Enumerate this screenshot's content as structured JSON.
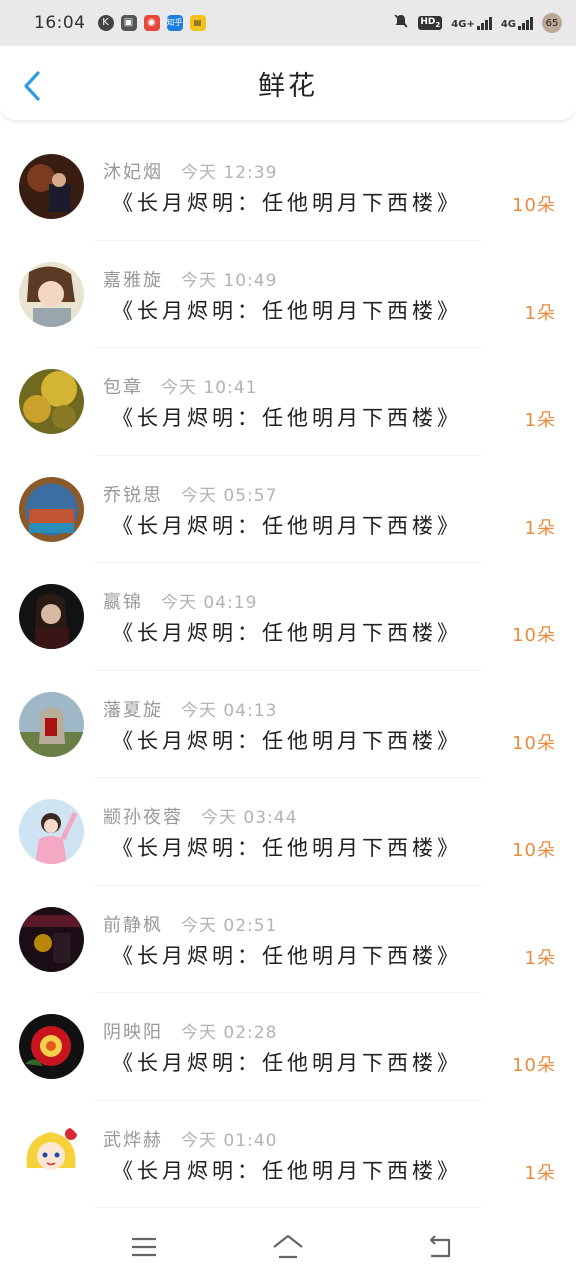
{
  "status_bar": {
    "time": "16:04",
    "left_icons": [
      "k-circle-icon",
      "square-app-icon",
      "weibo-icon",
      "zhihu-icon",
      "app-yellow-icon"
    ],
    "zhihu_text": "知乎",
    "network_1": "4G+",
    "network_2": "4G",
    "hd_label": "HD",
    "hd_sub": "2",
    "battery": "65"
  },
  "header": {
    "title": "鲜花",
    "back_icon": "chevron-left-icon"
  },
  "items": [
    {
      "name": "沐妃烟",
      "time": "今天 12:39",
      "book": "《长月烬明：任他明月下西楼》",
      "flowers": "10朵"
    },
    {
      "name": "嘉雅旋",
      "time": "今天 10:49",
      "book": "《长月烬明：任他明月下西楼》",
      "flowers": "1朵"
    },
    {
      "name": "包章",
      "time": "今天 10:41",
      "book": "《长月烬明：任他明月下西楼》",
      "flowers": "1朵"
    },
    {
      "name": "乔锐思",
      "time": "今天 05:57",
      "book": "《长月烬明：任他明月下西楼》",
      "flowers": "1朵"
    },
    {
      "name": "嬴锦",
      "time": "今天 04:19",
      "book": "《长月烬明：任他明月下西楼》",
      "flowers": "10朵"
    },
    {
      "name": "藩夏旋",
      "time": "今天 04:13",
      "book": "《长月烬明：任他明月下西楼》",
      "flowers": "10朵"
    },
    {
      "name": "颛孙夜蓉",
      "time": "今天 03:44",
      "book": "《长月烬明：任他明月下西楼》",
      "flowers": "10朵"
    },
    {
      "name": "前静枫",
      "time": "今天 02:51",
      "book": "《长月烬明：任他明月下西楼》",
      "flowers": "1朵"
    },
    {
      "name": "阴映阳",
      "time": "今天 02:28",
      "book": "《长月烬明：任他明月下西楼》",
      "flowers": "10朵"
    },
    {
      "name": "武烨赫",
      "time": "今天 01:40",
      "book": "《长月烬明：任他明月下西楼》",
      "flowers": "1朵"
    }
  ],
  "colors": {
    "accent_back": "#2f9be0",
    "flowers_text": "#e98b3e",
    "name_text": "#999999"
  },
  "bottom_nav": [
    "menu-icon",
    "home-icon",
    "back-icon"
  ]
}
